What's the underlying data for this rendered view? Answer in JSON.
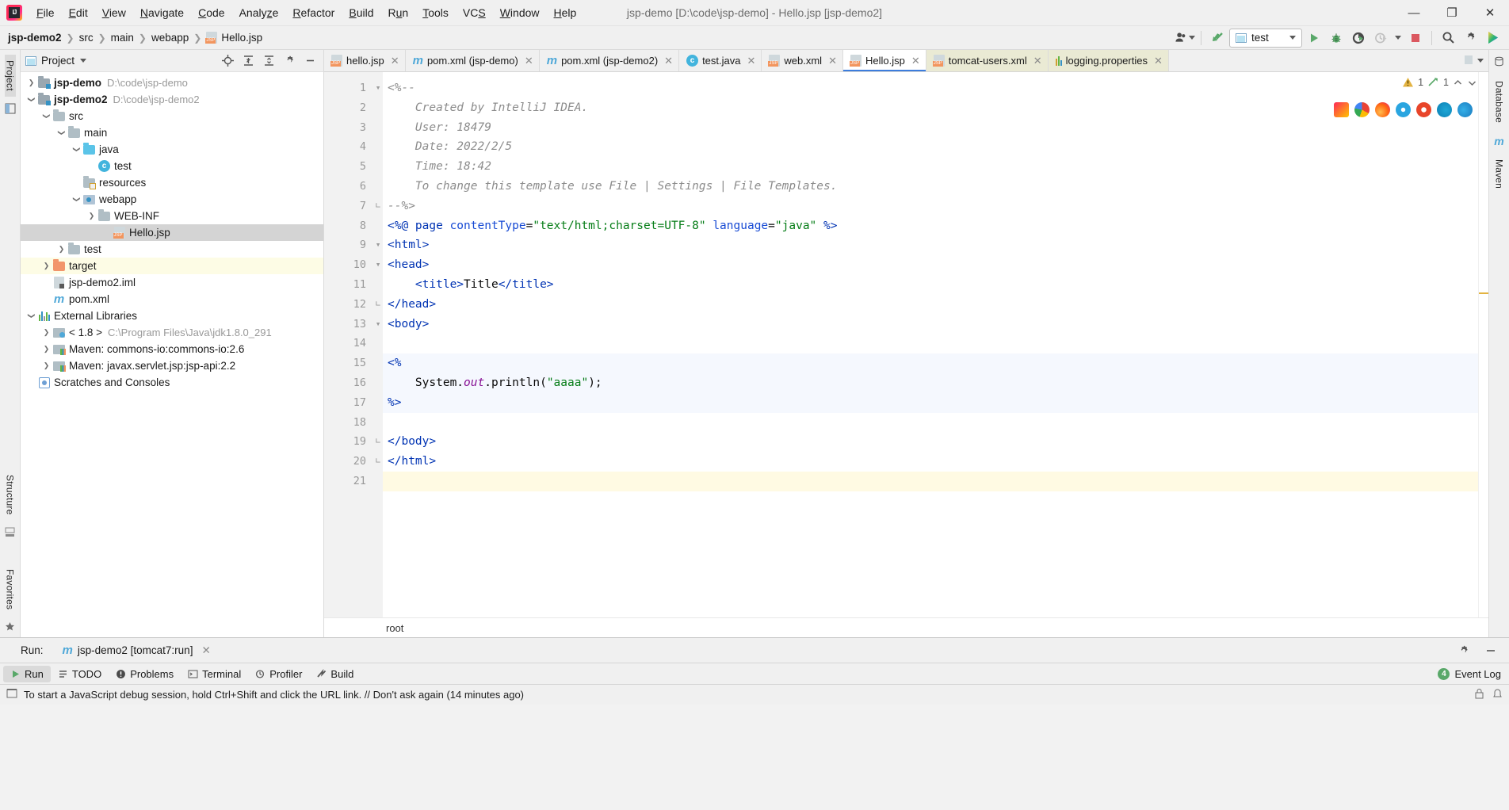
{
  "window": {
    "title": "jsp-demo [D:\\code\\jsp-demo] - Hello.jsp [jsp-demo2]",
    "minimize": "—",
    "maximize": "❐",
    "close": "✕"
  },
  "menu": [
    "File",
    "Edit",
    "View",
    "Navigate",
    "Code",
    "Analyze",
    "Refactor",
    "Build",
    "Run",
    "Tools",
    "VCS",
    "Window",
    "Help"
  ],
  "breadcrumb": [
    "jsp-demo2",
    "src",
    "main",
    "webapp",
    "Hello.jsp"
  ],
  "toolbar": {
    "run_config": "test",
    "run_label": "Run",
    "debug_label": "Debug",
    "coverage_label": "Run with Coverage",
    "profiler_label": "Profiler",
    "stop_label": "Stop",
    "search_label": "Search Everywhere",
    "settings_label": "Settings",
    "vcs_label": "Update Project",
    "user_label": "Account"
  },
  "project_panel": {
    "title": "Project",
    "icons": [
      "locate-icon",
      "expand-all-icon",
      "collapse-all-icon",
      "gear-icon",
      "hide-icon"
    ],
    "tree": [
      {
        "label": "jsp-demo",
        "path": "D:\\code\\jsp-demo",
        "indent": 0,
        "arrow": "collapsed",
        "icon": "module-folder-icon",
        "bold": true
      },
      {
        "label": "jsp-demo2",
        "path": "D:\\code\\jsp-demo2",
        "indent": 0,
        "arrow": "expanded",
        "icon": "module-folder-icon",
        "bold": true
      },
      {
        "label": "src",
        "path": "",
        "indent": 1,
        "arrow": "expanded",
        "icon": "folder-icon"
      },
      {
        "label": "main",
        "path": "",
        "indent": 2,
        "arrow": "expanded",
        "icon": "folder-icon"
      },
      {
        "label": "java",
        "path": "",
        "indent": 3,
        "arrow": "expanded",
        "icon": "source-folder-icon"
      },
      {
        "label": "test",
        "path": "",
        "indent": 4,
        "arrow": "none",
        "icon": "java-class-icon"
      },
      {
        "label": "resources",
        "path": "",
        "indent": 3,
        "arrow": "none",
        "icon": "resources-folder-icon"
      },
      {
        "label": "webapp",
        "path": "",
        "indent": 3,
        "arrow": "expanded",
        "icon": "webapp-folder-icon"
      },
      {
        "label": "WEB-INF",
        "path": "",
        "indent": 4,
        "arrow": "collapsed",
        "icon": "folder-icon"
      },
      {
        "label": "Hello.jsp",
        "path": "",
        "indent": 5,
        "arrow": "none",
        "icon": "jsp-file-icon",
        "selected": true
      },
      {
        "label": "test",
        "path": "",
        "indent": 2,
        "arrow": "collapsed",
        "icon": "folder-icon"
      },
      {
        "label": "target",
        "path": "",
        "indent": 1,
        "arrow": "collapsed",
        "icon": "target-folder-icon",
        "highlight": true
      },
      {
        "label": "jsp-demo2.iml",
        "path": "",
        "indent": 1,
        "arrow": "none",
        "icon": "iml-file-icon"
      },
      {
        "label": "pom.xml",
        "path": "",
        "indent": 1,
        "arrow": "none",
        "icon": "maven-file-icon"
      },
      {
        "label": "External Libraries",
        "path": "",
        "indent": 0,
        "arrow": "expanded",
        "icon": "libraries-icon"
      },
      {
        "label": "< 1.8 >",
        "path": "C:\\Program Files\\Java\\jdk1.8.0_291",
        "indent": 1,
        "arrow": "collapsed",
        "icon": "jdk-icon"
      },
      {
        "label": "Maven: commons-io:commons-io:2.6",
        "path": "",
        "indent": 1,
        "arrow": "collapsed",
        "icon": "maven-lib-icon"
      },
      {
        "label": "Maven: javax.servlet.jsp:jsp-api:2.2",
        "path": "",
        "indent": 1,
        "arrow": "collapsed",
        "icon": "maven-lib-icon"
      },
      {
        "label": "Scratches and Consoles",
        "path": "",
        "indent": 0,
        "arrow": "none",
        "icon": "scratches-icon"
      }
    ]
  },
  "rails": {
    "left_top": "Project",
    "left_mid": "Structure",
    "left_bottom": "Favorites",
    "right_top": "Database",
    "right_mid": "Maven"
  },
  "editor_tabs": [
    {
      "label": "hello.jsp",
      "icon": "jsp-file-icon",
      "active": false
    },
    {
      "label": "pom.xml (jsp-demo)",
      "icon": "maven-file-icon",
      "active": false
    },
    {
      "label": "pom.xml (jsp-demo2)",
      "icon": "maven-file-icon",
      "active": false
    },
    {
      "label": "test.java",
      "icon": "java-class-icon",
      "active": false
    },
    {
      "label": "web.xml",
      "icon": "xml-file-icon",
      "active": false
    },
    {
      "label": "Hello.jsp",
      "icon": "jsp-file-icon",
      "active": true
    },
    {
      "label": "tomcat-users.xml",
      "icon": "xml-file-icon",
      "active": false,
      "style": "tomcat"
    },
    {
      "label": "logging.properties",
      "icon": "properties-file-icon",
      "active": false,
      "style": "tomcat"
    }
  ],
  "editor": {
    "inspection_warnings": "1",
    "inspection_weak": "1",
    "breadcrumb_bottom": "root",
    "lines": [
      {
        "n": 1,
        "tokens": [
          {
            "t": "<%--",
            "c": "cmt"
          }
        ],
        "fold": "start"
      },
      {
        "n": 2,
        "tokens": [
          {
            "t": "    Created by IntelliJ IDEA.",
            "c": "cmt"
          }
        ]
      },
      {
        "n": 3,
        "tokens": [
          {
            "t": "    User: 18479",
            "c": "cmt"
          }
        ]
      },
      {
        "n": 4,
        "tokens": [
          {
            "t": "    Date: 2022/2/5",
            "c": "cmt"
          }
        ]
      },
      {
        "n": 5,
        "tokens": [
          {
            "t": "    Time: 18:42",
            "c": "cmt"
          }
        ]
      },
      {
        "n": 6,
        "tokens": [
          {
            "t": "    To change this template use File | Settings | File Templates.",
            "c": "cmt"
          }
        ]
      },
      {
        "n": 7,
        "tokens": [
          {
            "t": "--%>",
            "c": "cmt"
          }
        ],
        "fold": "end"
      },
      {
        "n": 8,
        "tokens": [
          {
            "t": "<%@ ",
            "c": "jspdir"
          },
          {
            "t": "page ",
            "c": "tag"
          },
          {
            "t": "contentType",
            "c": "attr"
          },
          {
            "t": "=",
            "c": "plain"
          },
          {
            "t": "\"text/html;charset=UTF-8\"",
            "c": "str"
          },
          {
            "t": " ",
            "c": "plain"
          },
          {
            "t": "language",
            "c": "attr"
          },
          {
            "t": "=",
            "c": "plain"
          },
          {
            "t": "\"java\"",
            "c": "str"
          },
          {
            "t": " %>",
            "c": "jspdir"
          }
        ]
      },
      {
        "n": 9,
        "tokens": [
          {
            "t": "<html>",
            "c": "tag"
          }
        ],
        "fold": "start"
      },
      {
        "n": 10,
        "tokens": [
          {
            "t": "<head>",
            "c": "tag"
          }
        ],
        "fold": "start"
      },
      {
        "n": 11,
        "tokens": [
          {
            "t": "    ",
            "c": "plain"
          },
          {
            "t": "<title>",
            "c": "tag"
          },
          {
            "t": "Title",
            "c": "plain"
          },
          {
            "t": "</title>",
            "c": "tag"
          }
        ]
      },
      {
        "n": 12,
        "tokens": [
          {
            "t": "</head>",
            "c": "tag"
          }
        ],
        "fold": "end"
      },
      {
        "n": 13,
        "tokens": [
          {
            "t": "<body>",
            "c": "tag"
          }
        ],
        "fold": "start"
      },
      {
        "n": 14,
        "tokens": [
          {
            "t": "",
            "c": "plain"
          }
        ]
      },
      {
        "n": 15,
        "tokens": [
          {
            "t": "<%",
            "c": "jspdir"
          }
        ],
        "block": true
      },
      {
        "n": 16,
        "tokens": [
          {
            "t": "    System.",
            "c": "plain"
          },
          {
            "t": "out",
            "c": "fld"
          },
          {
            "t": ".println(",
            "c": "plain"
          },
          {
            "t": "\"aaaa\"",
            "c": "str"
          },
          {
            "t": ");",
            "c": "plain"
          }
        ],
        "block": true
      },
      {
        "n": 17,
        "tokens": [
          {
            "t": "%>",
            "c": "jspdir"
          }
        ],
        "block": true
      },
      {
        "n": 18,
        "tokens": [
          {
            "t": "",
            "c": "plain"
          }
        ]
      },
      {
        "n": 19,
        "tokens": [
          {
            "t": "</body>",
            "c": "tag"
          }
        ],
        "fold": "end"
      },
      {
        "n": 20,
        "tokens": [
          {
            "t": "</html>",
            "c": "tag"
          }
        ],
        "fold": "end"
      },
      {
        "n": 21,
        "tokens": [
          {
            "t": "",
            "c": "plain"
          }
        ],
        "caret": true
      }
    ],
    "browser_icons": [
      "intellij-preview-icon",
      "chrome-icon",
      "firefox-icon",
      "safari-icon",
      "opera-icon",
      "edge-legacy-icon",
      "edge-icon"
    ]
  },
  "run_panel": {
    "label": "Run:",
    "tab": "jsp-demo2 [tomcat7:run]",
    "settings_label": "Settings",
    "hide_label": "Hide"
  },
  "toolwindows": [
    {
      "label": "Run",
      "icon": "run-icon",
      "active": true
    },
    {
      "label": "TODO",
      "icon": "todo-icon",
      "active": false
    },
    {
      "label": "Problems",
      "icon": "problems-icon",
      "active": false
    },
    {
      "label": "Terminal",
      "icon": "terminal-icon",
      "active": false
    },
    {
      "label": "Profiler",
      "icon": "profiler-icon",
      "active": false
    },
    {
      "label": "Build",
      "icon": "build-icon",
      "active": false
    }
  ],
  "event_log": {
    "label": "Event Log",
    "count": "4"
  },
  "statusbar": {
    "message": "To start a JavaScript debug session, hold Ctrl+Shift and click the URL link. // Don't ask again (14 minutes ago)"
  },
  "colors": {
    "accent_blue": "#3592c4",
    "green": "#59a869",
    "red": "#db5860",
    "warning": "#e3b341",
    "selection_gray": "#d4d4d4",
    "highlight_yellow": "#fdfce5"
  }
}
